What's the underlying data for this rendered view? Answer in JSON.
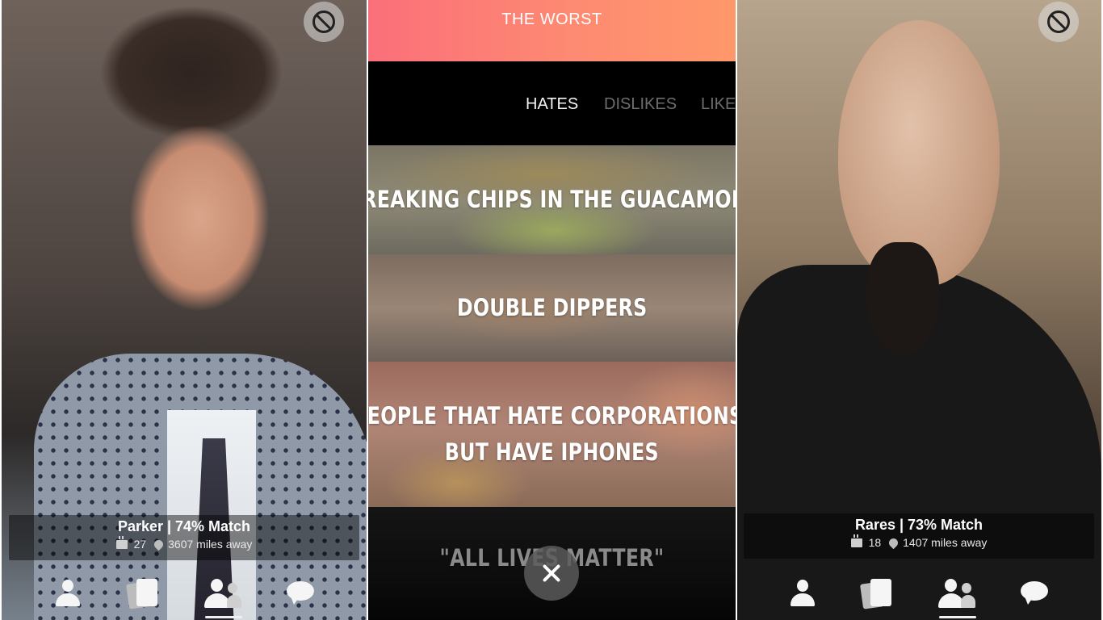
{
  "left_profile": {
    "name_match": "Parker | 74% Match",
    "age": "27",
    "distance": "3607 miles away"
  },
  "middle": {
    "header_title": "THE WORST",
    "tabs": [
      "HATES",
      "DISLIKES",
      "LIKE"
    ],
    "active_tab": "HATES",
    "cards": [
      "BREAKING CHIPS IN THE GUACAMOLE",
      "DOUBLE DIPPERS",
      "PEOPLE THAT HATE CORPORATIONS,",
      "BUT HAVE IPHONES",
      "\"ALL LIVES MATTER\""
    ]
  },
  "right_profile": {
    "name_match": "Rares | 73% Match",
    "age": "18",
    "distance": "1407 miles away"
  },
  "tabbar": {
    "icons": [
      "profile-icon",
      "cards-icon",
      "matches-icon",
      "chat-icon"
    ],
    "active": "matches-icon"
  },
  "colors": {
    "header_gradient_start": "#fb6f7a",
    "header_gradient_end": "#fe986a",
    "active_tab_text": "#f2f2f2",
    "inactive_tab_text": "#6d6d6d"
  }
}
